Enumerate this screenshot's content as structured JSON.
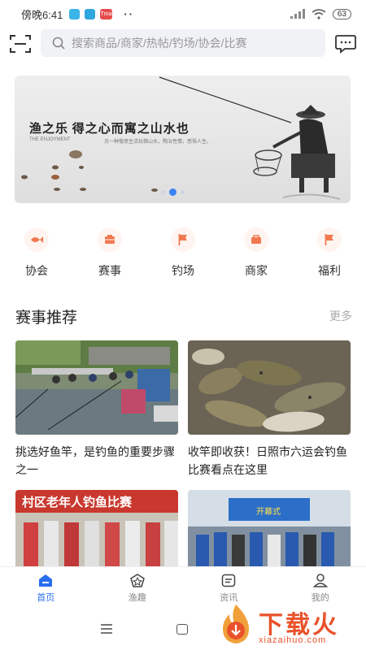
{
  "status_bar": {
    "time": "傍晚6:41",
    "notification_badge": "Tmall",
    "more_dots": "··",
    "battery": "63"
  },
  "search": {
    "placeholder": "搜索商品/商家/热帖/钓场/协会/比赛"
  },
  "banner": {
    "title": "渔之乐  得之心而寓之山水也",
    "subtitle": "THE ENJOYMENT",
    "subdesc": "另一种慢意生活玩佛山水，陶冶性情，感悟人生。",
    "pages": 3,
    "active_page": 2
  },
  "categories": [
    {
      "label": "协会",
      "icon": "fish-icon"
    },
    {
      "label": "赛事",
      "icon": "trophy-icon"
    },
    {
      "label": "钓场",
      "icon": "flag-icon"
    },
    {
      "label": "商家",
      "icon": "shop-icon"
    },
    {
      "label": "福利",
      "icon": "gift-flag-icon"
    }
  ],
  "section": {
    "title": "赛事推荐",
    "more": "更多"
  },
  "cards": [
    {
      "caption": "挑选好鱼竿，是钓鱼的重要步骤之一"
    },
    {
      "caption": "收竿即收获！日照市六运会钓鱼比赛看点在这里"
    }
  ],
  "cards_partial": [
    {
      "banner_text": "村区老年人钓鱼比赛"
    },
    {
      "banner_text": "开幕式"
    }
  ],
  "tabbar": [
    {
      "label": "首页",
      "active": true,
      "icon": "home-icon"
    },
    {
      "label": "渔趣",
      "active": false,
      "icon": "star-icon"
    },
    {
      "label": "资讯",
      "active": false,
      "icon": "news-icon"
    },
    {
      "label": "我的",
      "active": false,
      "icon": "user-icon"
    }
  ],
  "watermark": {
    "text": "下载火",
    "url": "xiazaihuo.com"
  },
  "colors": {
    "accent": "#2a6ff0",
    "category_icon": "#f0794f",
    "watermark": "#e9522a"
  }
}
